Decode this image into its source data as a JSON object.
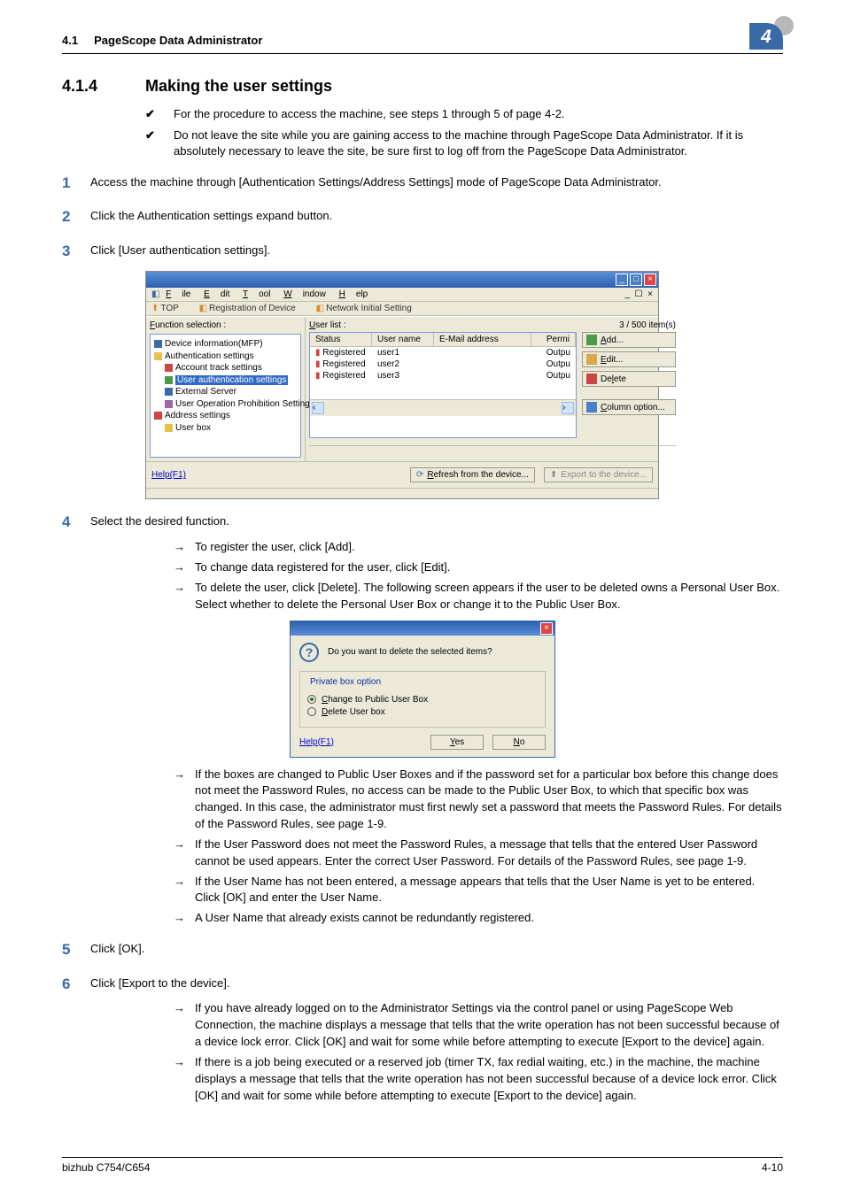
{
  "header": {
    "section": "4.1",
    "title": "PageScope Data Administrator",
    "chapter": "4"
  },
  "h2": {
    "num": "4.1.4",
    "text": "Making the user settings"
  },
  "checks": [
    "For the procedure to access the machine, see steps 1 through 5 of page 4-2.",
    "Do not leave the site while you are gaining access to the machine through PageScope Data Administrator. If it is absolutely necessary to leave the site, be sure first to log off from the PageScope Data Administrator."
  ],
  "steps": {
    "s1": "Access the machine through [Authentication Settings/Address Settings] mode of PageScope Data Administrator.",
    "s2": "Click the Authentication settings expand button.",
    "s3": "Click [User authentication settings].",
    "s4": "Select the desired function.",
    "s4subs": [
      "To register the user, click [Add].",
      "To change data registered for the user, click [Edit].",
      "To delete the user, click [Delete]. The following screen appears if the user to be deleted owns a Personal User Box. Select whether to delete the Personal User Box or change it to the Public User Box."
    ],
    "s4subs2": [
      "If the boxes are changed to Public User Boxes and if the password set for a particular box before this change does not meet the Password Rules, no access can be made to the Public User Box, to which that specific box was changed. In this case, the administrator must first newly set a password that meets the Password Rules. For details of the Password Rules, see page 1-9.",
      "If the User Password does not meet the Password Rules, a message that tells that the entered User Password cannot be used appears. Enter the correct User Password. For details of the Password Rules, see page 1-9.",
      "If the User Name has not been entered, a message appears that tells that the User Name is yet to be entered. Click [OK] and enter the User Name.",
      "A User Name that already exists cannot be redundantly registered."
    ],
    "s5": "Click [OK].",
    "s6": "Click [Export to the device].",
    "s6subs": [
      "If you have already logged on to the Administrator Settings via the control panel or using PageScope Web Connection, the machine displays a message that tells that the write operation has not been successful because of a device lock error. Click [OK] and wait for some while before attempting to execute [Export to the device] again.",
      "If there is a job being executed or a reserved job (timer TX, fax redial waiting, etc.) in the machine, the machine displays a message that tells that the write operation has not been successful because of a device lock error. Click [OK] and wait for some while before attempting to execute [Export to the device] again."
    ]
  },
  "app": {
    "menus": {
      "file": "File",
      "edit": "Edit",
      "tool": "Tool",
      "window": "Window",
      "help": "Help"
    },
    "tabs": {
      "top": "TOP",
      "reg": "Registration of Device",
      "net": "Network Initial Setting"
    },
    "leftLabel": "Function selection :",
    "tree": {
      "n1": "Device information(MFP)",
      "n2": "Authentication settings",
      "n3": "Account track settings",
      "n4": "User authentication settings",
      "n5": "External Server",
      "n6": "User Operation Prohibition Settings",
      "n7": "Address settings",
      "n8": "User box"
    },
    "listLabel": "User list :",
    "listCount": "3 / 500 item(s)",
    "cols": {
      "status": "Status",
      "user": "User name",
      "email": "E-Mail address",
      "perm": "Permi"
    },
    "rows": [
      {
        "status": "Registered",
        "user": "user1",
        "perm": "Outpu"
      },
      {
        "status": "Registered",
        "user": "user2",
        "perm": "Outpu"
      },
      {
        "status": "Registered",
        "user": "user3",
        "perm": "Outpu"
      }
    ],
    "btns": {
      "add": "Add...",
      "edit": "Edit...",
      "delete": "Delete",
      "colopt": "Column option..."
    },
    "help": "Help(F1)",
    "refresh": "Refresh from the device...",
    "export": "Export to the device..."
  },
  "dialog": {
    "msg": "Do you want to delete the selected items?",
    "legend": "Private box option",
    "opt1": "Change to Public User Box",
    "opt2": "Delete User box",
    "help": "Help(F1)",
    "yes": "Yes",
    "no": "No"
  },
  "footer": {
    "left": "bizhub C754/C654",
    "right": "4-10"
  }
}
